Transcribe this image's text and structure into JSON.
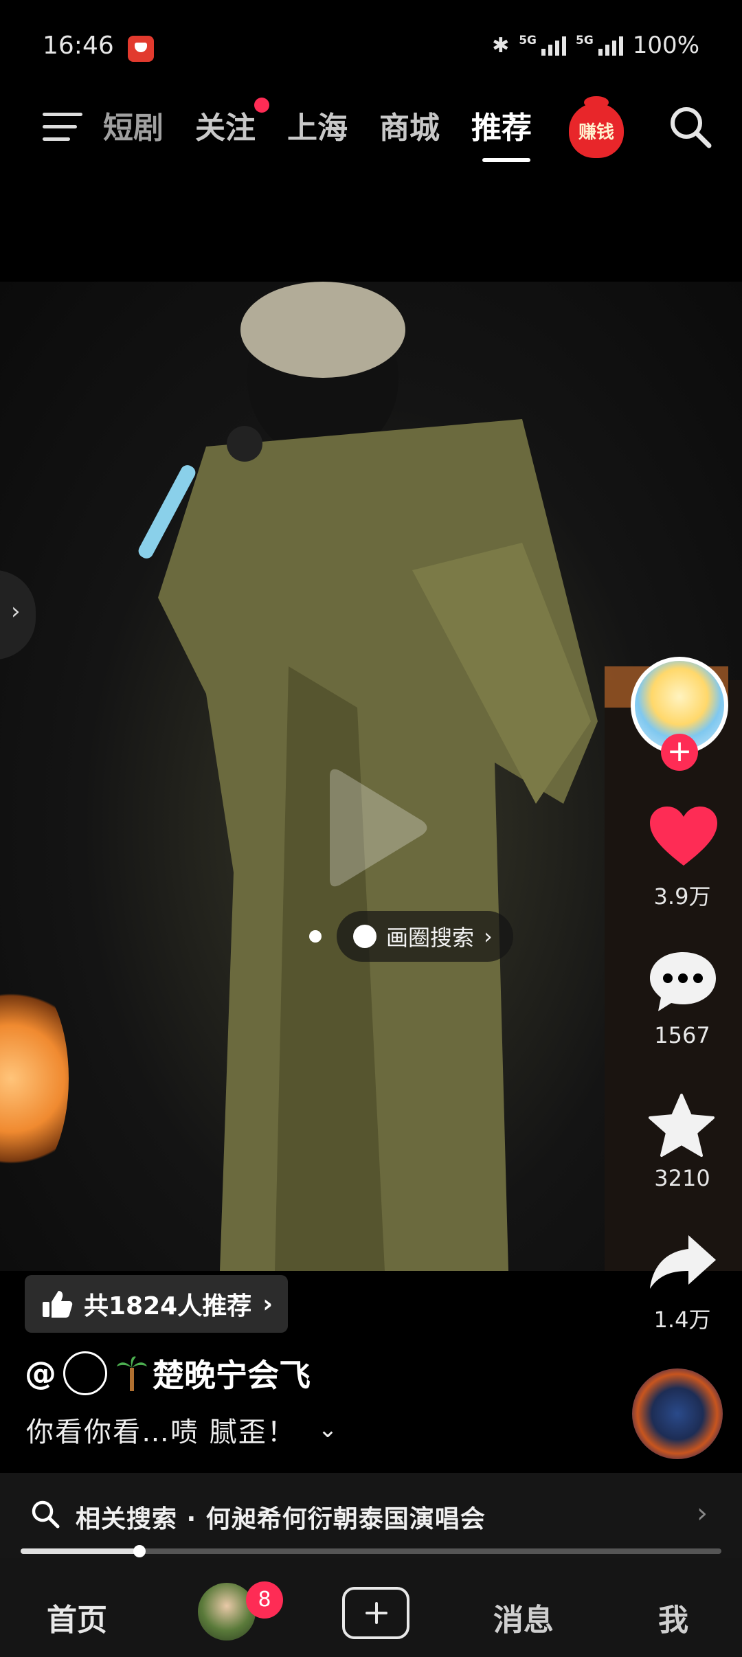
{
  "status_bar": {
    "time": "16:46",
    "network_1": "5G",
    "network_2": "5G",
    "battery": "100%"
  },
  "top_nav": {
    "tabs": [
      "短剧",
      "关注",
      "上海",
      "商城",
      "推荐"
    ],
    "active_tab": "推荐",
    "earn_label": "赚钱",
    "follow_has_dot": true
  },
  "video": {
    "circle_search_label": "画圈搜索",
    "overlay_watermark": "楚晚宁会飞"
  },
  "rail": {
    "like_count": "3.9万",
    "comment_count": "1567",
    "favorite_count": "3210",
    "share_count": "1.4万"
  },
  "info": {
    "recommend_label": "共1824人推荐",
    "author_name": "楚晚宁会飞",
    "author_prefix": "@",
    "caption": "你看你看…啧 腻歪！"
  },
  "related_search": {
    "text": "相关搜索 · 何昶希何衍朝泰国演唱会",
    "progress": 0.17
  },
  "bottom_nav": {
    "home": "首页",
    "friends_badge": "8",
    "messages": "消息",
    "me": "我"
  },
  "colors": {
    "accent": "#fe2c55",
    "background": "#000000"
  }
}
